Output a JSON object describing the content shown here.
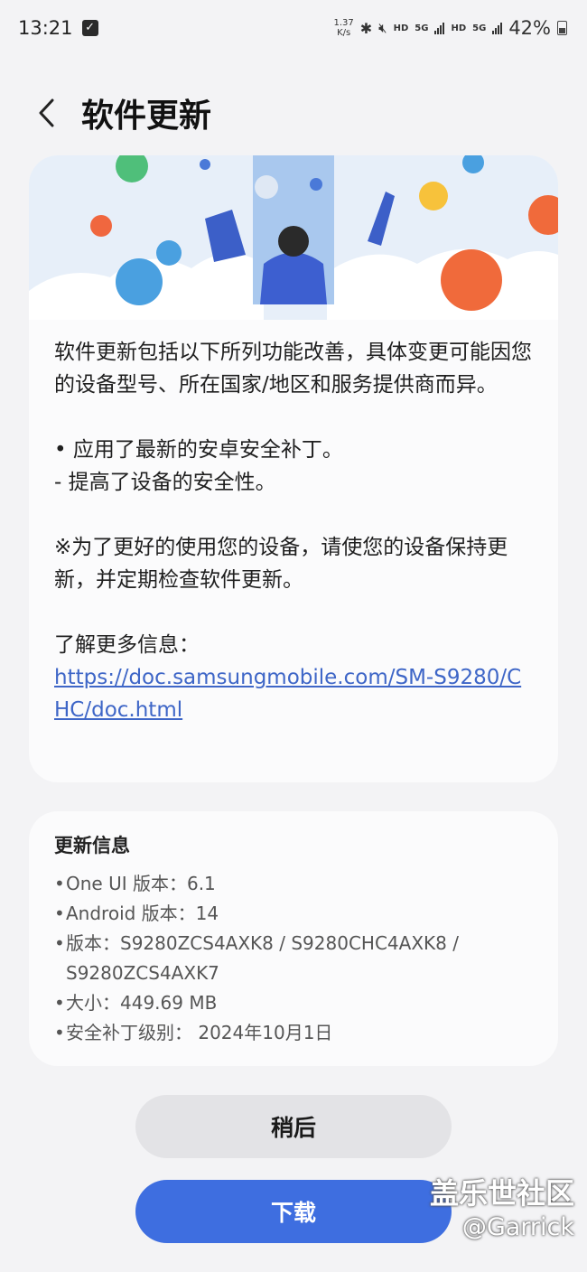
{
  "status_bar": {
    "time": "13:21",
    "speed_value": "1.37",
    "speed_unit": "K/s",
    "hd1": "HD",
    "net1": "5G",
    "hd2": "HD",
    "net2": "5G",
    "battery": "42%"
  },
  "header": {
    "title": "软件更新"
  },
  "main_card": {
    "intro": "软件更新包括以下所列功能改善，具体变更可能因您的设备型号、所在国家/地区和服务提供商而异。",
    "bullet1": "• 应用了最新的安卓安全补丁。",
    "bullet1_sub": " - 提高了设备的安全性。",
    "note": "※为了更好的使用您的设备，请使您的设备保持更新，并定期检查软件更新。",
    "more_label": "了解更多信息：",
    "link": "https://doc.samsungmobile.com/SM-S9280/CHC/doc.html"
  },
  "info_card": {
    "title": "更新信息",
    "items": [
      {
        "text": "One UI 版本：6.1"
      },
      {
        "text": "Android 版本：14"
      },
      {
        "text": "版本：S9280ZCS4AXK8 / S9280CHC4AXK8 / S9280ZCS4AXK7"
      },
      {
        "text": "大小：449.69 MB"
      },
      {
        "text": "安全补丁级别： 2024年10月1日"
      }
    ]
  },
  "buttons": {
    "later": "稍后",
    "download": "下载"
  },
  "watermark": {
    "line1": "盖乐世社区",
    "line2": "@Garrick"
  },
  "colors": {
    "accent": "#3e6ee0",
    "link": "#3e66c7",
    "background": "#f3f3f5",
    "card": "#fbfbfc"
  }
}
